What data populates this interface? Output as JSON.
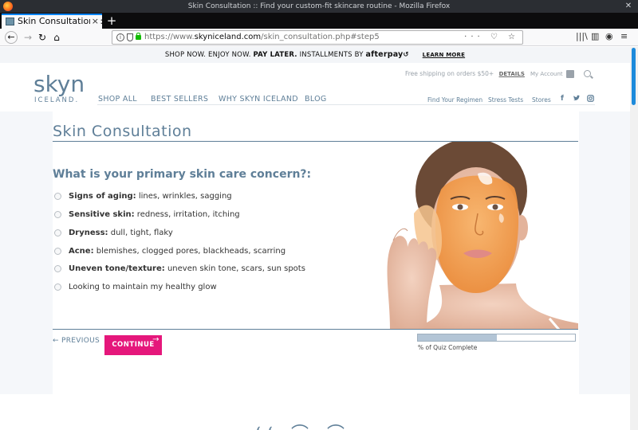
{
  "window": {
    "title": "Skin Consultation :: Find your custom-fit skincare routine - Mozilla Firefox"
  },
  "tab": {
    "label": "Skin Consultation :: F",
    "close_glyph": "×",
    "new_tab_glyph": "+"
  },
  "nav": {
    "back_glyph": "←",
    "forward_glyph": "→",
    "reload_glyph": "↻",
    "home_glyph": "⌂",
    "url_scheme": "https://www.",
    "url_host": "skyniceland.com",
    "url_path": "/skin_consultation.php#step5",
    "url_actions": "··· ♡ ☆",
    "library_glyph": "|||\\",
    "sidebar_glyph": "▥",
    "account_glyph": "◉",
    "menu_glyph": "≡"
  },
  "promo": {
    "part1": "SHOP NOW. ENJOY NOW. ",
    "part2": "PAY LATER.",
    "part3": "  INSTALLMENTS BY ",
    "brand": "afterpay",
    "learn": "LEARN MORE"
  },
  "logo": {
    "skyn": "skyn",
    "iceland": "ICELAND."
  },
  "header": {
    "free_shipping": "Free shipping on orders $50+",
    "details": "DETAILS",
    "my_account": "My Account",
    "icons": [
      "bag-icon",
      "search-icon"
    ]
  },
  "main_nav": [
    "SHOP ALL",
    "BEST SELLERS",
    "WHY SKYN ICELAND",
    "BLOG"
  ],
  "sub_nav": [
    "Find Your Regimen",
    "Stress Tests",
    "Stores"
  ],
  "social": [
    "f",
    "t",
    "ig"
  ],
  "consultation": {
    "title": "Skin Consultation",
    "question": "What is your primary skin care concern?:",
    "options": [
      {
        "label": "Signs of aging:",
        "desc": " lines, wrinkles, sagging"
      },
      {
        "label": "Sensitive skin:",
        "desc": " redness, irritation, itching"
      },
      {
        "label": "Dryness:",
        "desc": " dull, tight, flaky"
      },
      {
        "label": "Acne:",
        "desc": " blemishes, clogged pores, blackheads, scarring"
      },
      {
        "label": "Uneven tone/texture:",
        "desc": " uneven skin tone, scars, sun spots"
      },
      {
        "label": "",
        "desc": "Looking to maintain my healthy glow"
      }
    ],
    "previous": "PREVIOUS",
    "continue": "CONTINUE",
    "progress_label": "% of Quiz Complete",
    "progress_fraction": 0.5
  },
  "colors": {
    "brand_blue": "#5f7f98",
    "accent_pink": "#e5177b",
    "mask_orange": "#f4a65a"
  }
}
